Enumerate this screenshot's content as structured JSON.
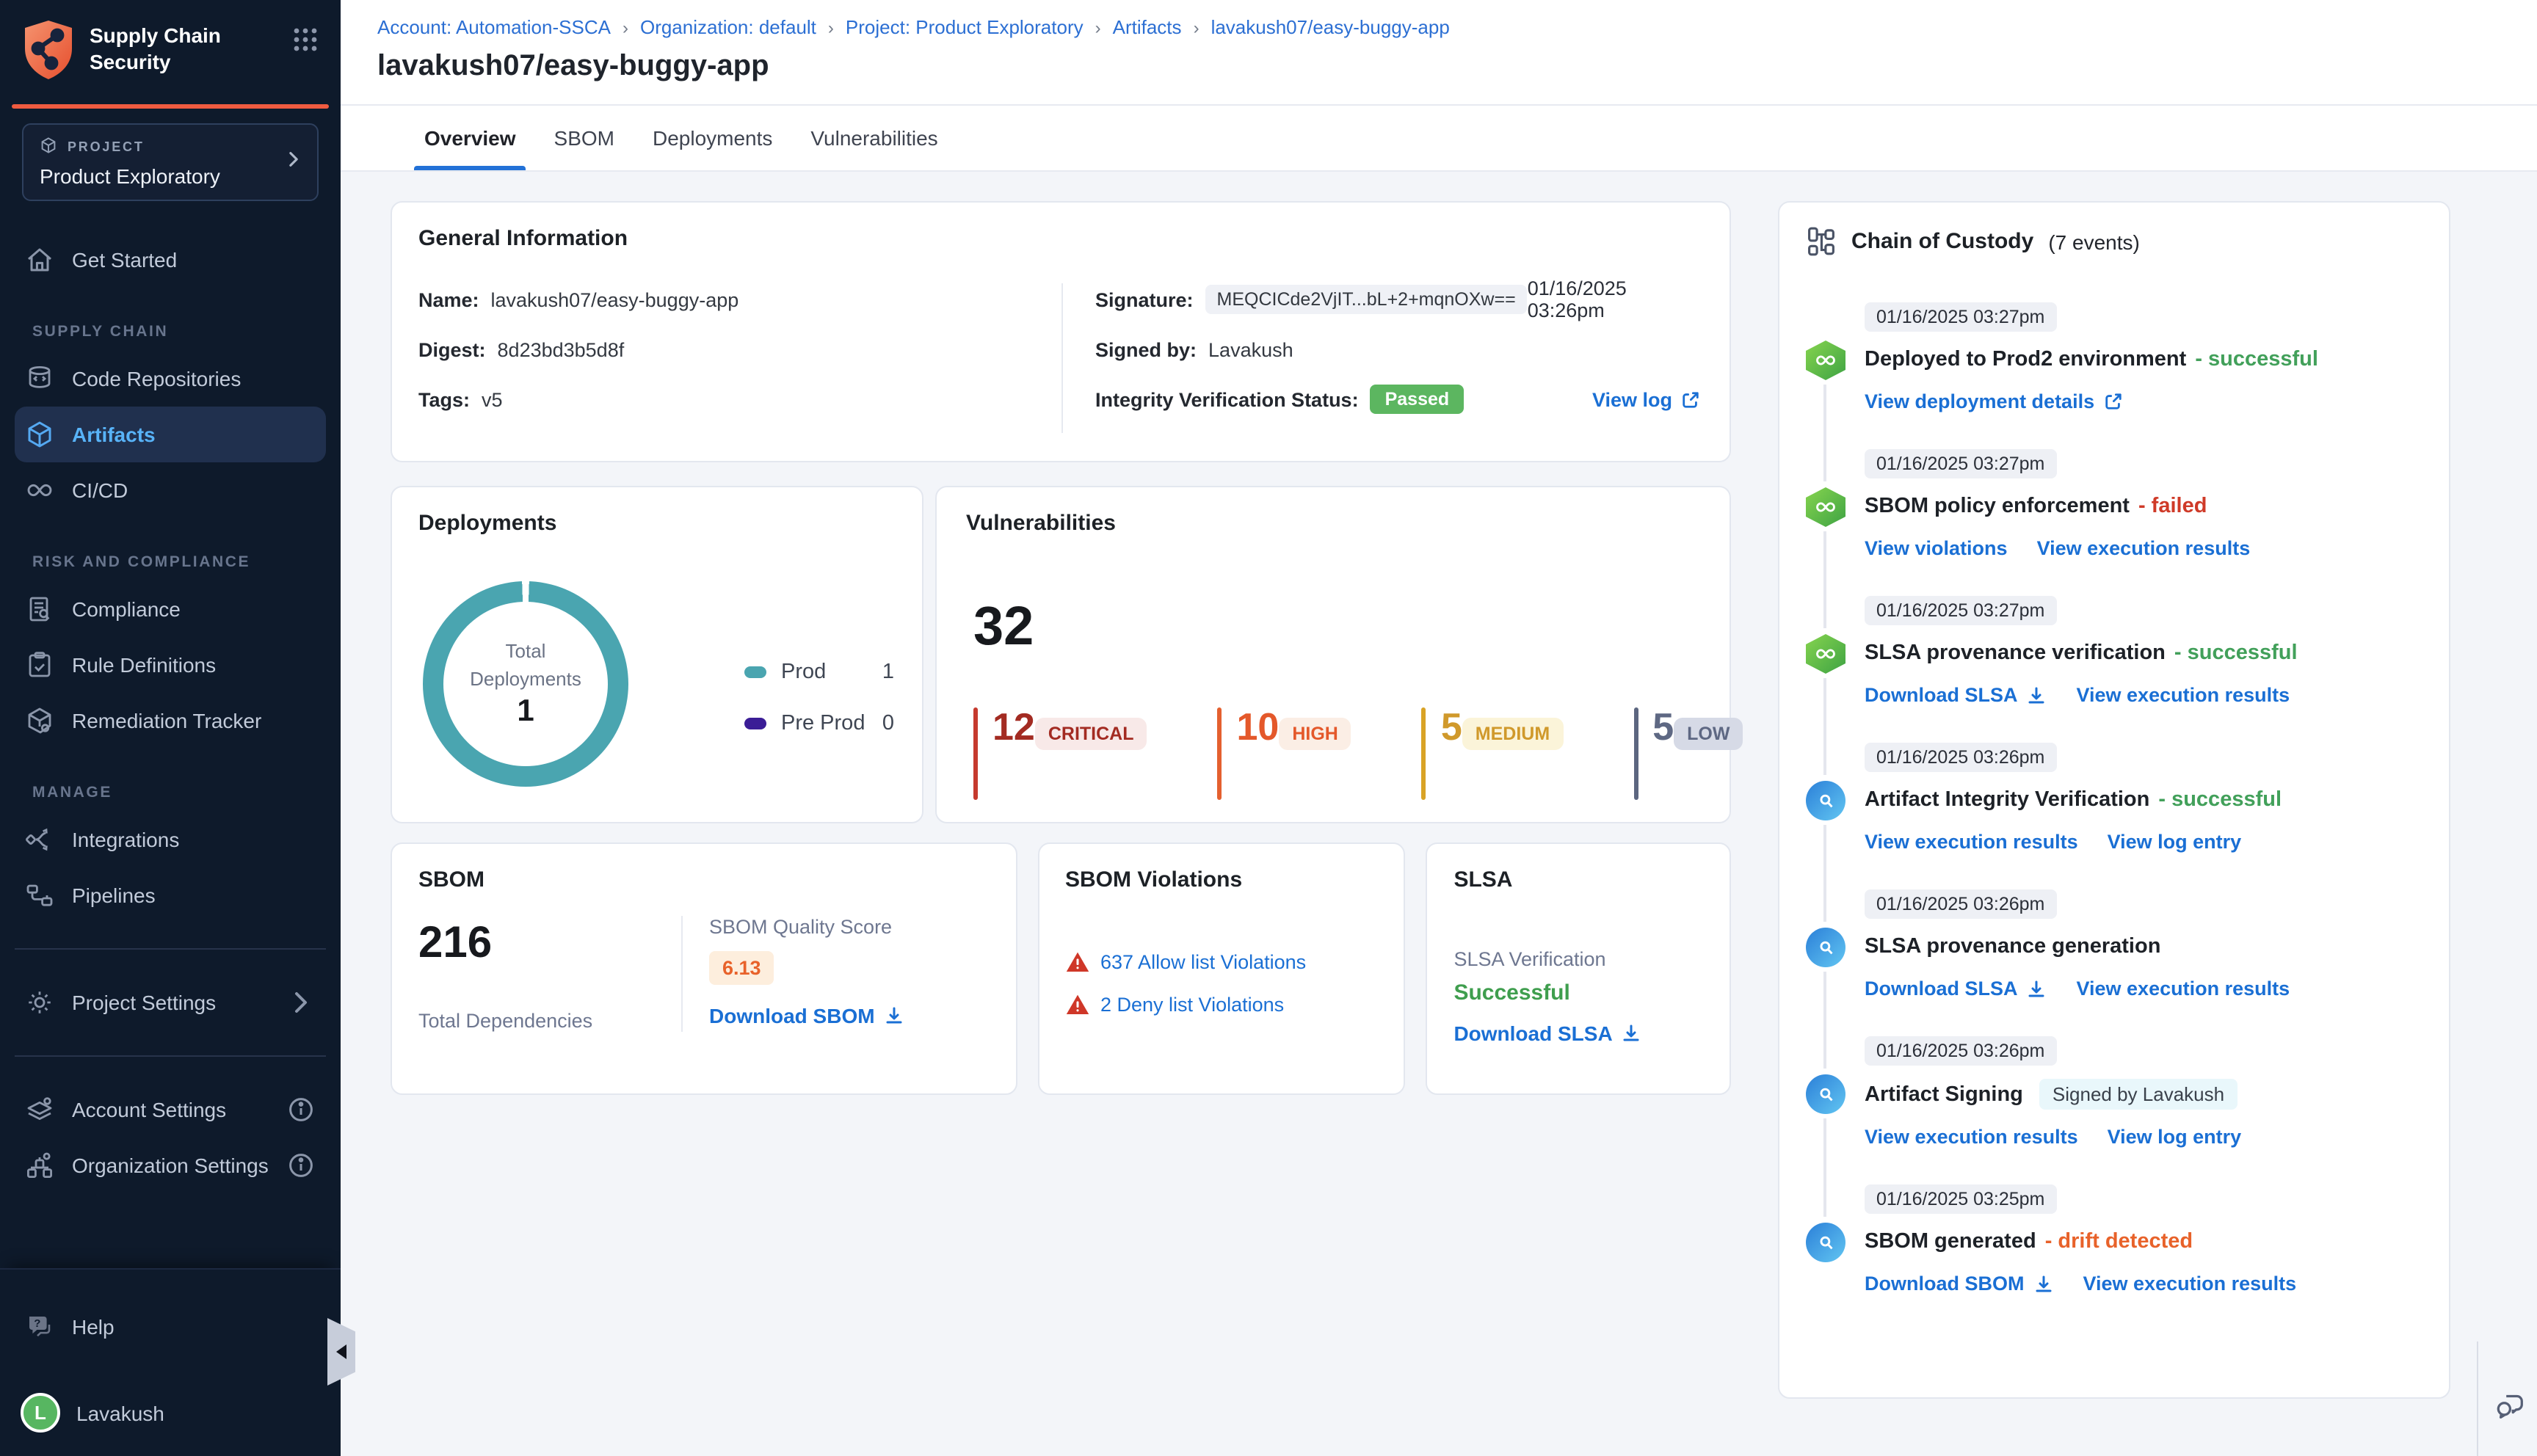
{
  "brand": {
    "name_line1": "Supply Chain",
    "name_line2": "Security"
  },
  "project_selector": {
    "eyebrow": "PROJECT",
    "name": "Product Exploratory"
  },
  "sidebar": {
    "get_started": "Get Started",
    "section1_label": "SUPPLY CHAIN",
    "section2_label": "RISK AND COMPLIANCE",
    "section3_label": "MANAGE",
    "items": {
      "code_repositories": "Code Repositories",
      "artifacts": "Artifacts",
      "cicd": "CI/CD",
      "compliance": "Compliance",
      "rule_definitions": "Rule Definitions",
      "remediation_tracker": "Remediation Tracker",
      "integrations": "Integrations",
      "pipelines": "Pipelines",
      "project_settings": "Project Settings",
      "account_settings": "Account Settings",
      "organization_settings": "Organization Settings"
    },
    "help": "Help",
    "user_initial": "L",
    "user_name": "Lavakush"
  },
  "breadcrumb": {
    "separator": "›",
    "items": [
      "Account: Automation-SSCA",
      "Organization: default",
      "Project: Product Exploratory",
      "Artifacts",
      "lavakush07/easy-buggy-app"
    ]
  },
  "page_title": "lavakush07/easy-buggy-app",
  "tabs": {
    "overview": "Overview",
    "sbom": "SBOM",
    "deployments": "Deployments",
    "vulnerabilities": "Vulnerabilities"
  },
  "general_info": {
    "title": "General Information",
    "name_label": "Name:",
    "name_value": "lavakush07/easy-buggy-app",
    "digest_label": "Digest:",
    "digest_value": "8d23bd3b5d8f",
    "tags_label": "Tags:",
    "tags_value": "v5",
    "signature_label": "Signature:",
    "signature_value": "MEQCICde2VjIT...bL+2+mqnOXw==",
    "signature_date": "01/16/2025 03:26pm",
    "signed_by_label": "Signed by:",
    "signed_by_value": "Lavakush",
    "integrity_label": "Integrity Verification Status:",
    "integrity_status": "Passed",
    "view_log": "View log"
  },
  "deployments": {
    "title": "Deployments",
    "donut_label_line1": "Total",
    "donut_label_line2": "Deployments",
    "total": "1",
    "legend": [
      {
        "name": "Prod",
        "value": "1"
      },
      {
        "name": "Pre Prod",
        "value": "0"
      }
    ],
    "chart_data": {
      "type": "pie",
      "title": "Total Deployments",
      "categories": [
        "Prod",
        "Pre Prod"
      ],
      "values": [
        1,
        0
      ],
      "colors": [
        "#4aa5b0",
        "#3b1d96"
      ],
      "legend_position": "right"
    }
  },
  "vulnerabilities": {
    "title": "Vulnerabilities",
    "total": "32",
    "severities": [
      {
        "count": "12",
        "label": "CRITICAL"
      },
      {
        "count": "10",
        "label": "HIGH"
      },
      {
        "count": "5",
        "label": "MEDIUM"
      },
      {
        "count": "5",
        "label": "LOW"
      }
    ]
  },
  "sbom": {
    "title": "SBOM",
    "total": "216",
    "total_label": "Total Dependencies",
    "quality_label": "SBOM Quality Score",
    "quality_score": "6.13",
    "download": "Download SBOM"
  },
  "sbom_violations": {
    "title": "SBOM Violations",
    "allow": "637 Allow list Violations",
    "deny": "2 Deny list Violations"
  },
  "slsa": {
    "title": "SLSA",
    "verification_label": "SLSA Verification",
    "verification_status": "Successful",
    "download": "Download SLSA"
  },
  "chain_of_custody": {
    "title": "Chain of Custody",
    "count": "(7 events)",
    "events": [
      {
        "time": "01/16/2025 03:27pm",
        "title": "Deployed to Prod2 environment",
        "status": "- successful",
        "links": [
          {
            "label": "View deployment details"
          }
        ]
      },
      {
        "time": "01/16/2025 03:27pm",
        "title": "SBOM policy enforcement",
        "status": "- failed",
        "links": [
          {
            "label": "View violations"
          },
          {
            "label": "View execution results"
          }
        ]
      },
      {
        "time": "01/16/2025 03:27pm",
        "title": "SLSA provenance verification",
        "status": "- successful",
        "links": [
          {
            "label": "Download SLSA"
          },
          {
            "label": "View execution results"
          }
        ]
      },
      {
        "time": "01/16/2025 03:26pm",
        "title": "Artifact Integrity Verification",
        "status": "- successful",
        "links": [
          {
            "label": "View execution results"
          },
          {
            "label": "View log entry"
          }
        ]
      },
      {
        "time": "01/16/2025 03:26pm",
        "title": "SLSA provenance generation",
        "links": [
          {
            "label": "Download SLSA"
          },
          {
            "label": "View execution results"
          }
        ]
      },
      {
        "time": "01/16/2025 03:26pm",
        "title": "Artifact Signing",
        "badge": "Signed by Lavakush",
        "links": [
          {
            "label": "View execution results"
          },
          {
            "label": "View log entry"
          }
        ]
      },
      {
        "time": "01/16/2025 03:25pm",
        "title": "SBOM generated",
        "status": "- drift detected",
        "links": [
          {
            "label": "Download SBOM"
          },
          {
            "label": "View execution results"
          }
        ]
      }
    ]
  },
  "colors": {
    "accent_orange": "#ef5b40",
    "link_blue": "#1a6fd4",
    "success_green": "#42a05a",
    "fail_red": "#cf3a28",
    "drift_orange": "#e8622a",
    "prod_teal": "#4aa5b0",
    "preprod_purple": "#3b1d96",
    "passed_green": "#5cb660"
  }
}
